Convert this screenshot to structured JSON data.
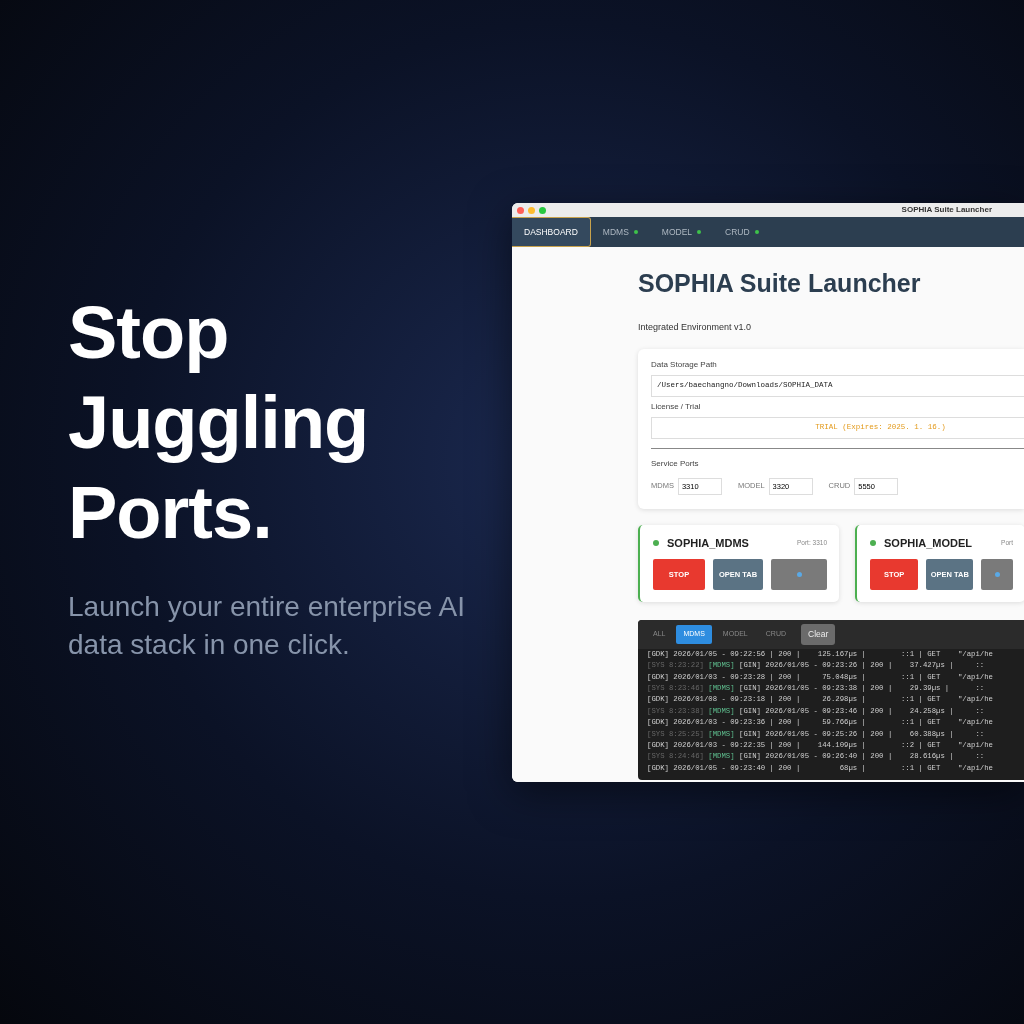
{
  "hero": {
    "headline": "Stop Juggling Ports.",
    "subline": "Launch your entire enterprise AI data stack in one click."
  },
  "window": {
    "title": "SOPHIA Suite Launcher"
  },
  "tabs": [
    {
      "label": "DASHBOARD",
      "selected": true
    },
    {
      "label": "MDMS",
      "selected": false,
      "running": true
    },
    {
      "label": "MODEL",
      "selected": false,
      "running": true
    },
    {
      "label": "CRUD",
      "selected": false,
      "running": true
    }
  ],
  "heading": "SOPHIA Suite Launcher",
  "subheading": "Integrated Environment v1.0",
  "settings": {
    "path_label": "Data Storage Path",
    "path_value": "/Users/baechangno/Downloads/SOPHIA_DATA",
    "license_label": "License / Trial",
    "license_value": "TRIAL (Expires: 2025. 1. 16.)",
    "ports_label": "Service Ports",
    "ports": [
      {
        "label": "MDMS",
        "value": "3310"
      },
      {
        "label": "MODEL",
        "value": "3320"
      },
      {
        "label": "CRUD",
        "value": "5550"
      }
    ]
  },
  "services": [
    {
      "name": "SOPHIA_MDMS",
      "port": "Port: 3310",
      "running": true,
      "buttons": [
        {
          "kind": "danger",
          "label": "STOP"
        },
        {
          "kind": "secondary",
          "label": "OPEN TAB"
        },
        {
          "kind": "icon"
        }
      ]
    },
    {
      "name": "SOPHIA_MODEL",
      "port": "Port",
      "running": true,
      "buttons": [
        {
          "kind": "danger",
          "label": "STOP"
        },
        {
          "kind": "secondary",
          "label": "OPEN TAB"
        },
        {
          "kind": "icon"
        }
      ]
    }
  ],
  "log": {
    "filters": [
      {
        "label": "ALL",
        "selected": false
      },
      {
        "label": "MDMS",
        "selected": true
      },
      {
        "label": "MODEL",
        "selected": false
      },
      {
        "label": "CRUD",
        "selected": false
      }
    ],
    "clear": "Clear",
    "lines": [
      {
        "text": "[GDK] 2026/01/05 - 09:22:56 | 200 |    125.167µs |        ::1 | GET    \"/api/he"
      },
      {
        "prefix": "[SYS 8:23:22]",
        "tag": "[MDMS]",
        "text": "[GIN] 2026/01/05 - 09:23:26 | 200 |    37.427µs |     ::"
      },
      {
        "text": "[GDK] 2026/01/03 - 09:23:28 | 200 |     75.048µs |        ::1 | GET    \"/api/he"
      },
      {
        "prefix": "[SYS 8:23:46]",
        "tag": "[MDMS]",
        "text": "[GIN] 2026/01/05 - 09:23:38 | 200 |    29.39µs |      ::"
      },
      {
        "text": "[GDK] 2026/01/08 - 09:23:18 | 200 |     26.298µs |        ::1 | GET    \"/api/he"
      },
      {
        "prefix": "[SYS 8:23:38]",
        "tag": "[MDMS]",
        "text": "[GIN] 2026/01/05 - 09:23:46 | 200 |    24.258µs |     ::"
      },
      {
        "text": "[GDK] 2026/01/03 - 09:23:36 | 200 |     59.766µs |        ::1 | GET    \"/api/he"
      },
      {
        "prefix": "[SYS 8:25:25]",
        "tag": "[MDMS]",
        "text": "[GIN] 2026/01/05 - 09:25:26 | 200 |    60.388µs |     ::"
      },
      {
        "text": "[GDK] 2026/01/03 - 09:22:35 | 200 |    144.109µs |        ::2 | GET    \"/api/he"
      },
      {
        "prefix": "[SYS 8:24:46]",
        "tag": "[MDMS]",
        "text": "[GIN] 2026/01/05 - 09:26:40 | 200 |    28.616µs |     ::"
      },
      {
        "text": "[GDK] 2026/01/05 - 09:23:40 | 200 |         68µs |        ::1 | GET    \"/api/he"
      }
    ]
  }
}
